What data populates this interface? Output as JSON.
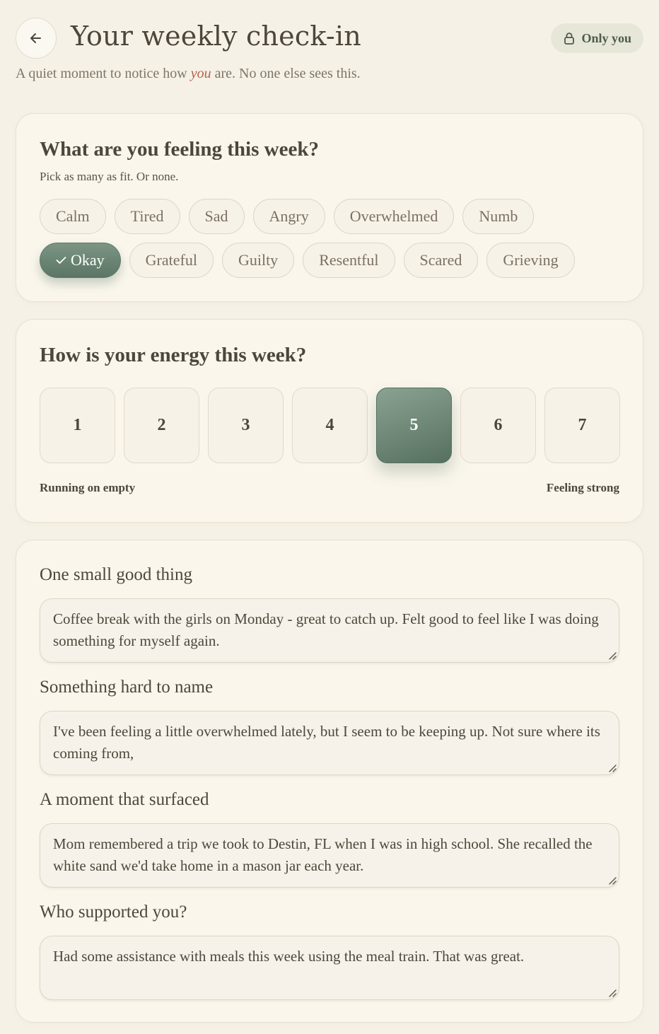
{
  "header": {
    "title": "Your weekly check-in",
    "privacy_label": "Only you",
    "subtitle_before": "A quiet moment to notice how ",
    "subtitle_emphasis": "you",
    "subtitle_after": " are. No one else sees this."
  },
  "feelings": {
    "title": "What are you feeling this week?",
    "subtitle": "Pick as many as fit. Or none.",
    "row1": [
      {
        "label": "Calm",
        "selected": false
      },
      {
        "label": "Tired",
        "selected": false
      },
      {
        "label": "Sad",
        "selected": false
      },
      {
        "label": "Angry",
        "selected": false
      },
      {
        "label": "Overwhelmed",
        "selected": false
      },
      {
        "label": "Numb",
        "selected": false
      }
    ],
    "row2": [
      {
        "label": "Okay",
        "selected": true
      },
      {
        "label": "Grateful",
        "selected": false
      },
      {
        "label": "Guilty",
        "selected": false
      },
      {
        "label": "Resentful",
        "selected": false
      },
      {
        "label": "Scared",
        "selected": false
      },
      {
        "label": "Grieving",
        "selected": false
      }
    ]
  },
  "energy": {
    "title": "How is your energy this week?",
    "options": [
      "1",
      "2",
      "3",
      "4",
      "5",
      "6",
      "7"
    ],
    "selected": 5,
    "low_label": "Running on empty",
    "high_label": "Feeling strong"
  },
  "reflections": [
    {
      "label": "One small good thing",
      "value": "Coffee break with the girls on Monday - great to catch up. Felt good to feel like I was doing something for myself again."
    },
    {
      "label": "Something hard to name",
      "value": "I've been feeling a little overwhelmed lately, but I seem to be keeping up. Not sure where its coming from,"
    },
    {
      "label": "A moment that surfaced",
      "value": "Mom remembered a trip we took to Destin, FL when I was in high school. She recalled the white sand we'd take home in a mason jar each year."
    },
    {
      "label": "Who supported you?",
      "value": "Had some assistance with meals this week using the meal train. That was great."
    }
  ],
  "colors": {
    "background": "#f6f1e6",
    "accent_green": "#5b7666",
    "emphasis": "#b4614e"
  },
  "icons": {
    "back": "arrow-left-icon",
    "privacy": "lock-icon",
    "check": "check-icon",
    "resize": "resize-grip-icon"
  }
}
